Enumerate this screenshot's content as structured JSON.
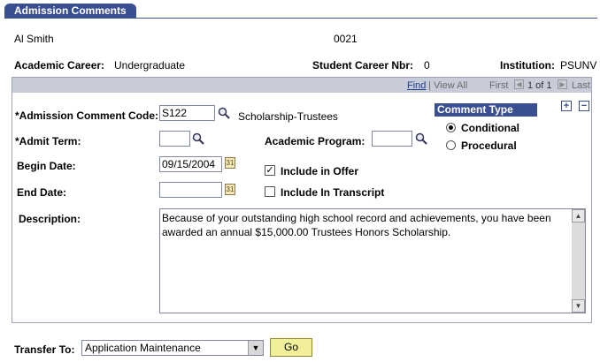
{
  "tab": {
    "label": "Admission Comments"
  },
  "student": {
    "name": "Al Smith",
    "id": "0021"
  },
  "career": {
    "academic_career_label": "Academic Career:",
    "academic_career_value": "Undergraduate",
    "career_nbr_label": "Student Career Nbr:",
    "career_nbr_value": "0",
    "institution_label": "Institution:",
    "institution_value": "PSUNV"
  },
  "nav": {
    "find": "Find",
    "view_all": "View All",
    "sep": "|",
    "first": "First",
    "range": "1 of 1",
    "last": "Last"
  },
  "form": {
    "comment_code_label": "*Admission Comment Code:",
    "comment_code_value": "S122",
    "comment_code_desc": "Scholarship-Trustees",
    "admit_term_label": "*Admit Term:",
    "admit_term_value": "",
    "academic_program_label": "Academic Program:",
    "academic_program_value": "",
    "begin_date_label": "Begin Date:",
    "begin_date_value": "09/15/2004",
    "end_date_label": "End Date:",
    "end_date_value": "",
    "include_offer_label": "Include in Offer",
    "include_offer_checked": true,
    "include_transcript_label": "Include In Transcript",
    "include_transcript_checked": false,
    "description_label": "Description:",
    "description_value": "Because of your outstanding high school record and achievements, you have been awarded an annual $15,000.00 Trustees Honors Scholarship."
  },
  "comment_type": {
    "title": "Comment Type",
    "options": [
      {
        "label": "Conditional",
        "selected": true
      },
      {
        "label": "Procedural",
        "selected": false
      }
    ]
  },
  "transfer": {
    "label": "Transfer To:",
    "selected": "Application Maintenance",
    "go_label": "Go"
  },
  "colors": {
    "header_blue": "#3a4f91",
    "go_yellow": "#f2ef9a",
    "panel_head": "#c8ccd8"
  }
}
